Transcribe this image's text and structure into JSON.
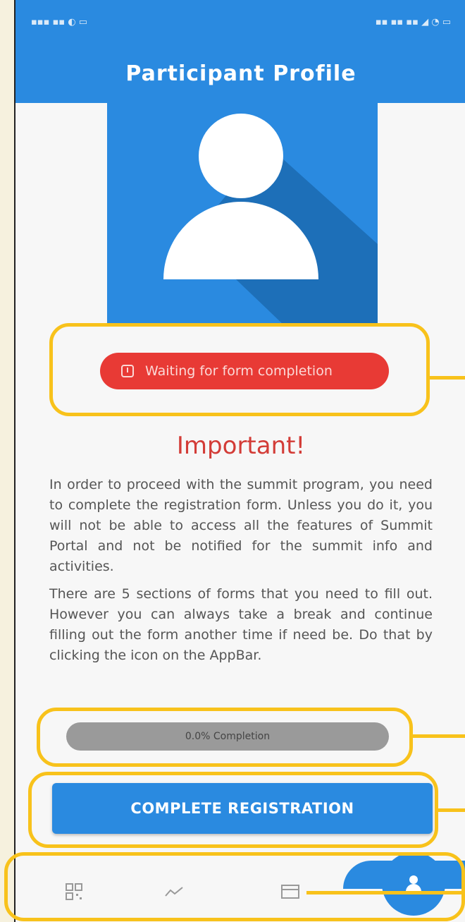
{
  "appbar": {
    "title": "Participant Profile"
  },
  "status_chip": {
    "label": "Waiting for form completion"
  },
  "notice": {
    "heading": "Important!",
    "paragraph_1": "In order to proceed with the summit program, you need to complete the registration form. Unless you do it, you will not be able to access all the features of Summit Portal and not be notified for the summit info and activities.",
    "paragraph_2": "There are 5 sections of forms that you need to fill out. However you can always take a break and continue filling out the form another time if need be. Do that by clicking the icon on the AppBar."
  },
  "progress": {
    "label": "0.0% Completion",
    "value": 0.0
  },
  "cta": {
    "label": "COMPLETE REGISTRATION"
  },
  "bottom_nav": {
    "items": [
      {
        "icon": "qr-code-icon"
      },
      {
        "icon": "activity-chart-icon"
      },
      {
        "icon": "card-icon"
      },
      {
        "icon": "person-icon",
        "active": true
      }
    ]
  },
  "colors": {
    "primary": "#2a8ae0",
    "alert": "#e83a35",
    "highlight": "#f8c21b",
    "background": "#f7f7f7"
  }
}
